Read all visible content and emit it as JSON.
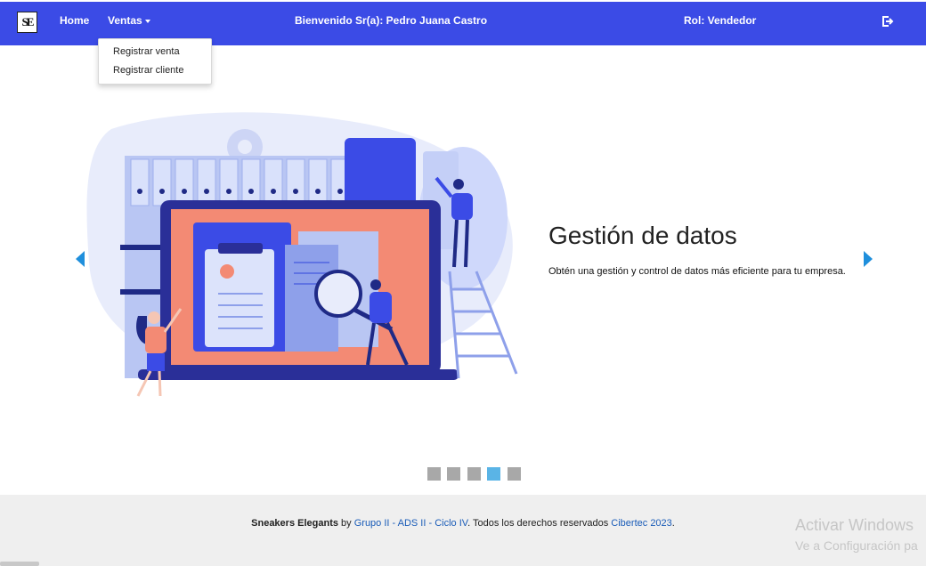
{
  "navbar": {
    "logo_text": "SE",
    "home_label": "Home",
    "ventas_label": "Ventas",
    "welcome_text": "Bienvenido Sr(a): Pedro Juana Castro",
    "role_text": "Rol: Vendedor",
    "logout_icon": "logout-icon",
    "background_color": "#3b4be6"
  },
  "ventas_menu": {
    "items": [
      {
        "label": "Registrar venta"
      },
      {
        "label": "Registrar cliente"
      }
    ]
  },
  "carousel": {
    "title": "Gestión de datos",
    "description": "Obtén una gestión y control de datos más eficiente para tu empresa.",
    "slide_count": 5,
    "active_index": 3,
    "prev_icon": "chevron-left-icon",
    "next_icon": "chevron-right-icon",
    "arrow_color": "#1f8fdc",
    "indicator_color": "#a8a8a8",
    "indicator_active_color": "#5ab4e6"
  },
  "footer": {
    "brand": "Sneakers Elegants",
    "by": " by ",
    "group": "Grupo II - ADS II - Ciclo IV",
    "rights": ". Todos los derechos reservados ",
    "org": "Cibertec 2023",
    "end": "."
  },
  "watermark": {
    "line1": "Activar Windows",
    "line2": "Ve a Configuración pa"
  }
}
